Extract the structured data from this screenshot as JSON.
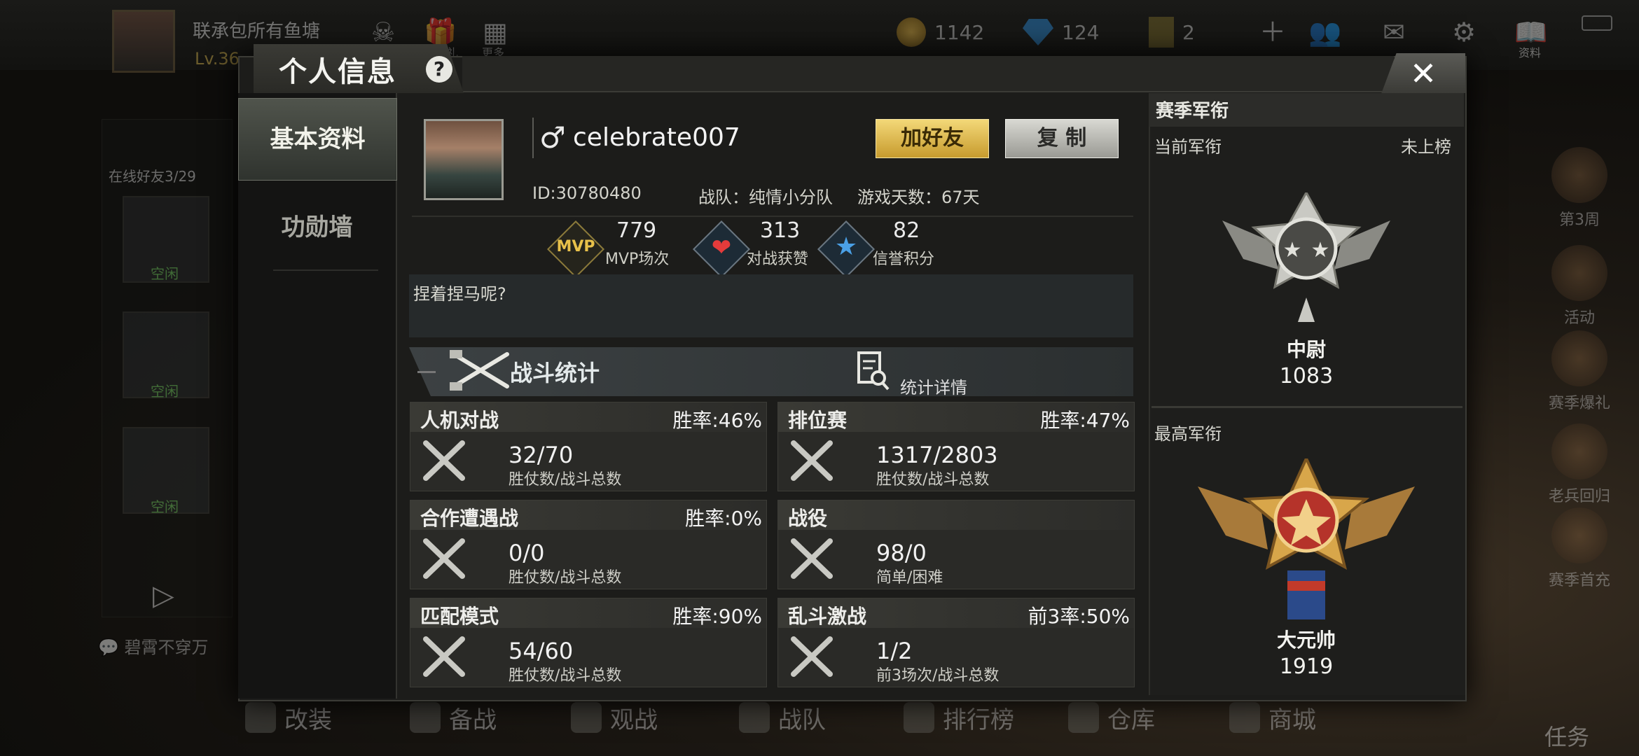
{
  "background": {
    "player_name": "联承包所有鱼塘",
    "player_level": "Lv.36",
    "gold": "1142",
    "diamonds": "124",
    "tickets": "2",
    "top_labels": [
      "首充有礼",
      "更多",
      "资料"
    ],
    "friends_online": "在线好友3/29",
    "friend_status": [
      "空闲",
      "空闲",
      "空闲"
    ],
    "chat_preview": "碧霄不穿万",
    "right_menu": [
      "第3周",
      "活动",
      "赛季爆礼",
      "老兵回归",
      "赛季首充"
    ],
    "task": "任务",
    "bottom_nav": [
      "改装",
      "备战",
      "观战",
      "战队",
      "排行榜",
      "仓库",
      "商城"
    ]
  },
  "dialog": {
    "title": "个人信息",
    "help": "?",
    "close": "✕",
    "tabs": [
      "基本资料",
      "功勋墙"
    ]
  },
  "profile": {
    "gender_symbol": "♂",
    "name": "celebrate007",
    "add_friend": "加好友",
    "copy": "复 制",
    "id": "ID:30780480",
    "team": "战队：纯情小分队",
    "days": "游戏天数：67天",
    "stats": [
      {
        "num": "779",
        "label": "MVP场次",
        "icon": "mvp-icon"
      },
      {
        "num": "313",
        "label": "对战获赞",
        "icon": "heart-icon"
      },
      {
        "num": "82",
        "label": "信誉积分",
        "icon": "star-icon"
      }
    ],
    "mvp_text": "MVP",
    "motto": "捏着捏马呢?"
  },
  "battle": {
    "title": "战斗统计",
    "detail": "统计详情",
    "modes": [
      {
        "name": "人机对战",
        "rate": "胜率:46%",
        "value": "32/70",
        "sub": "胜仗数/战斗总数"
      },
      {
        "name": "排位赛",
        "rate": "胜率:47%",
        "value": "1317/2803",
        "sub": "胜仗数/战斗总数"
      },
      {
        "name": "合作遭遇战",
        "rate": "胜率:0%",
        "value": "0/0",
        "sub": "胜仗数/战斗总数"
      },
      {
        "name": "战役",
        "rate": "",
        "value": "98/0",
        "sub": "简单/困难"
      },
      {
        "name": "匹配模式",
        "rate": "胜率:90%",
        "value": "54/60",
        "sub": "胜仗数/战斗总数"
      },
      {
        "name": "乱斗激战",
        "rate": "前3率:50%",
        "value": "1/2",
        "sub": "前3场次/战斗总数"
      }
    ]
  },
  "rank": {
    "title": "赛季军衔",
    "current_label": "当前军衔",
    "current_status": "未上榜",
    "current_name": "中尉",
    "current_score": "1083",
    "highest_label": "最高军衔",
    "highest_name": "大元帅",
    "highest_score": "1919"
  },
  "colors": {
    "gold_button": "#e0b84a",
    "accent_silver": "#bdbdb6",
    "heart": "#e53b3b",
    "star": "#4aa0e6"
  }
}
